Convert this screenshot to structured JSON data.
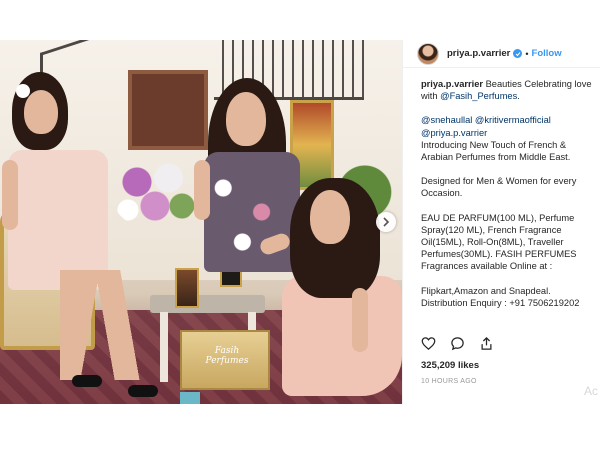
{
  "post": {
    "username": "priya.p.varrier",
    "follow_label": "Follow",
    "dot": "•",
    "caption": {
      "line1_user": "priya.p.varrier",
      "line1_text": " Beauties Celebrating love with ",
      "line1_mention": "@Fasih_Perfumes",
      "line1_end": ".",
      "mentions_a": "@snehaullal",
      "mentions_b": "@kritivermaofficial",
      "mentions_c": "@priya.p.varrier",
      "intro": "Introducing New Touch of French & Arabian Perfumes from Middle East.",
      "designed": "Designed for Men & Women for every Occasion.",
      "products": "EAU DE PARFUM(100 ML), Perfume Spray(120 ML), French Fragrance Oil(15ML), Roll-On(8ML), Traveller Perfumes(30ML). FASIH PERFUMES Fragrances available Online at :",
      "stores": "Flipkart,Amazon and Snapdeal.",
      "enquiry": "Distribution Enquiry : +91 7506219202"
    },
    "likes": "325,209 likes",
    "time": "10 HOURS AGO",
    "photo_box_label": "Fasih Perfumes"
  },
  "watermark": "Ac",
  "icons": {
    "like": "heart-icon",
    "comment": "comment-icon",
    "share": "share-icon",
    "next": "chevron-right-icon",
    "verified": "verified-badge-icon"
  },
  "colors": {
    "link": "#3897f0",
    "mention": "#003569",
    "text": "#262626",
    "muted": "#999999"
  }
}
